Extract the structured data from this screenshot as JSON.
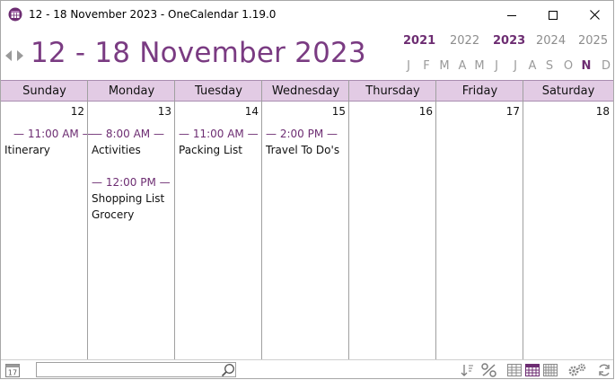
{
  "window": {
    "title": "12 - 18 November 2023 - OneCalendar 1.19.0"
  },
  "header": {
    "title": "12 - 18 November 2023",
    "years": [
      {
        "label": "2021",
        "bold": true
      },
      {
        "label": "2022",
        "bold": false
      },
      {
        "label": "2023",
        "bold": true
      },
      {
        "label": "2024",
        "bold": false
      },
      {
        "label": "2025",
        "bold": false
      }
    ],
    "months": [
      {
        "label": "J",
        "bold": false
      },
      {
        "label": "F",
        "bold": false
      },
      {
        "label": "M",
        "bold": false
      },
      {
        "label": "A",
        "bold": false
      },
      {
        "label": "M",
        "bold": false
      },
      {
        "label": "J",
        "bold": false
      },
      {
        "label": "J",
        "bold": false
      },
      {
        "label": "A",
        "bold": false
      },
      {
        "label": "S",
        "bold": false
      },
      {
        "label": "O",
        "bold": false
      },
      {
        "label": "N",
        "bold": true
      },
      {
        "label": "D",
        "bold": false
      }
    ]
  },
  "days": [
    {
      "name": "Sunday",
      "date": "12",
      "events": [
        {
          "time": "11:00 AM",
          "items": [
            "Itinerary"
          ]
        }
      ]
    },
    {
      "name": "Monday",
      "date": "13",
      "events": [
        {
          "time": "8:00 AM",
          "items": [
            "Activities"
          ]
        },
        {
          "time": "12:00 PM",
          "items": [
            "Shopping List",
            "Grocery"
          ]
        }
      ]
    },
    {
      "name": "Tuesday",
      "date": "14",
      "events": [
        {
          "time": "11:00 AM",
          "items": [
            "Packing List"
          ]
        }
      ]
    },
    {
      "name": "Wednesday",
      "date": "15",
      "events": [
        {
          "time": "2:00 PM",
          "items": [
            "Travel To Do's"
          ]
        }
      ]
    },
    {
      "name": "Thursday",
      "date": "16",
      "events": []
    },
    {
      "name": "Friday",
      "date": "17",
      "events": []
    },
    {
      "name": "Saturday",
      "date": "18",
      "events": []
    }
  ],
  "statusbar": {
    "today_icon_day": "17",
    "search_value": "",
    "search_placeholder": ""
  },
  "colors": {
    "accent": "#7a3b82",
    "accent_dark": "#6d2d72",
    "header_bg": "#e2cbe4"
  }
}
